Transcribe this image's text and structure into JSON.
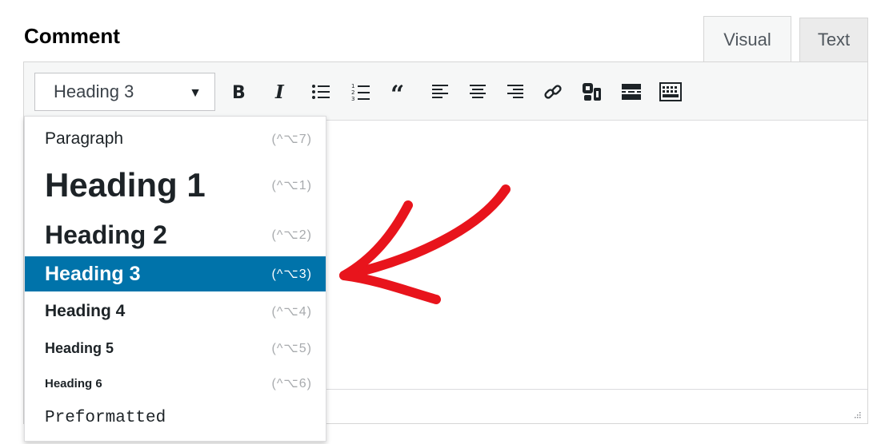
{
  "field": {
    "label": "Comment"
  },
  "tabs": [
    {
      "label": "Visual",
      "active": true
    },
    {
      "label": "Text",
      "active": false
    }
  ],
  "format_select": {
    "value": "Heading 3"
  },
  "toolbar_icons": [
    "bold-icon",
    "italic-icon",
    "bulleted-list-icon",
    "numbered-list-icon",
    "blockquote-icon",
    "align-left-icon",
    "align-center-icon",
    "align-right-icon",
    "link-icon",
    "form-embed-icon",
    "read-more-icon",
    "toolbar-toggle-icon"
  ],
  "menu": {
    "items": [
      {
        "label": "Paragraph",
        "shortcut": "(^⌥7)"
      },
      {
        "label": "Heading 1",
        "shortcut": "(^⌥1)"
      },
      {
        "label": "Heading 2",
        "shortcut": "(^⌥2)"
      },
      {
        "label": "Heading 3",
        "shortcut": "(^⌥3)",
        "selected": true
      },
      {
        "label": "Heading 4",
        "shortcut": "(^⌥4)"
      },
      {
        "label": "Heading 5",
        "shortcut": "(^⌥5)"
      },
      {
        "label": "Heading 6",
        "shortcut": "(^⌥6)"
      },
      {
        "label": "Preformatted",
        "shortcut": ""
      }
    ]
  },
  "colors": {
    "accent": "#0073aa",
    "annotation": "#e8141c",
    "toolbar_bg": "#f6f7f7"
  }
}
